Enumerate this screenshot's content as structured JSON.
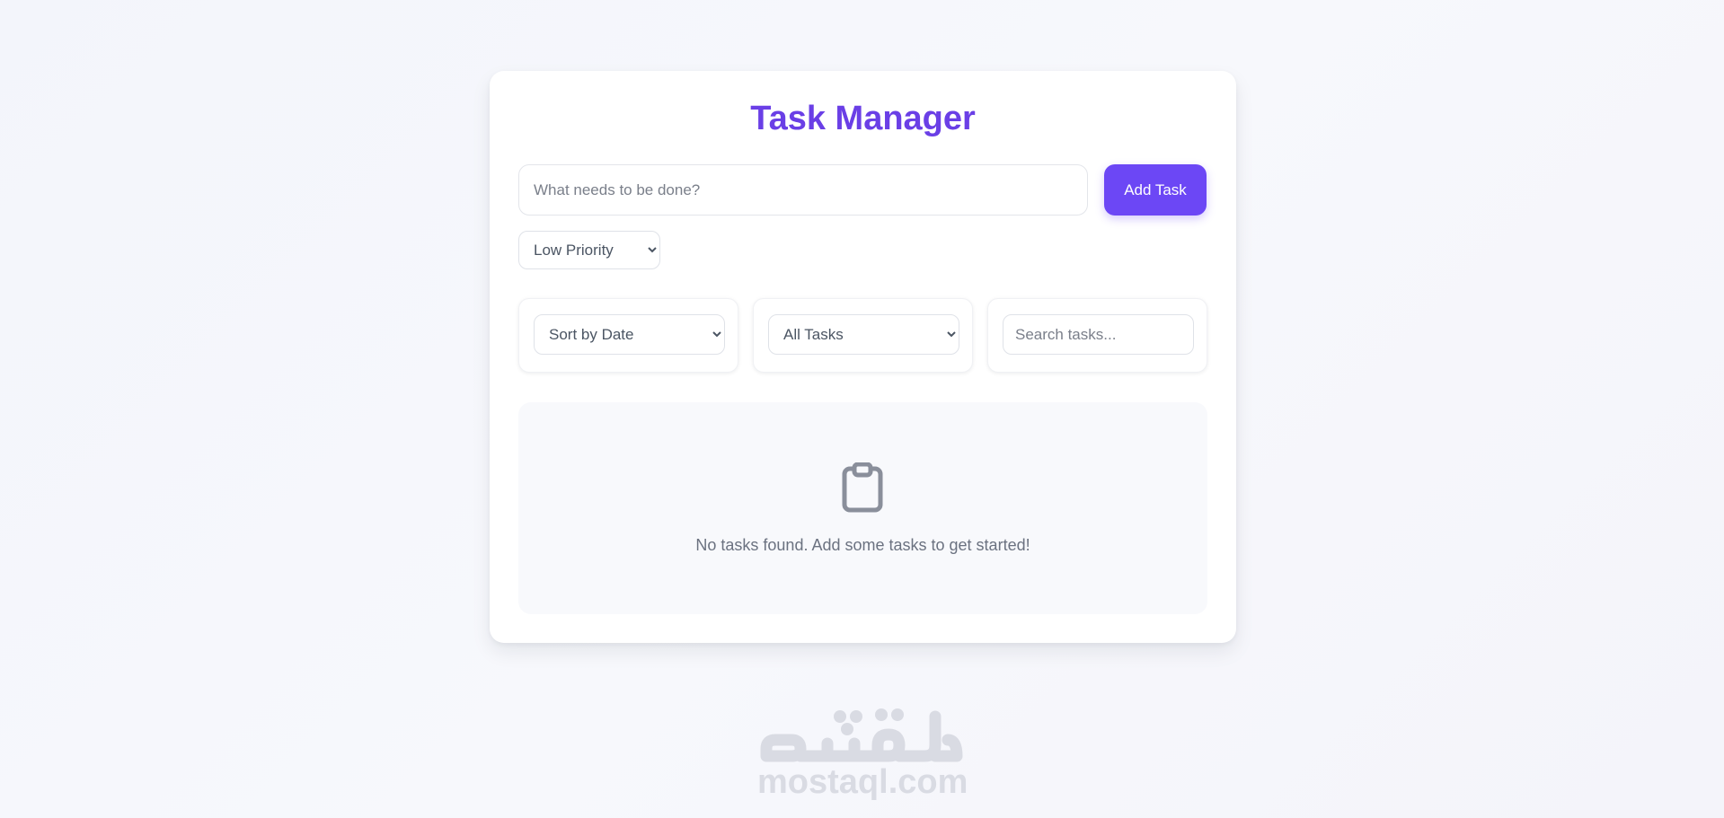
{
  "app": {
    "title": "Task Manager"
  },
  "new_task": {
    "placeholder": "What needs to be done?",
    "add_label": "Add Task",
    "priority_selected": "Low Priority"
  },
  "filters": {
    "sort_selected": "Sort by Date",
    "status_selected": "All Tasks",
    "search_placeholder": "Search tasks..."
  },
  "empty_state": {
    "icon": "clipboard-icon",
    "message": "No tasks found. Add some tasks to get started!"
  },
  "watermark": {
    "brand_arabic": "مستقل",
    "site": "mostaql.com"
  },
  "colors": {
    "accent": "#6c47f5",
    "title": "#6a3fe6",
    "muted_text": "#6b7280",
    "panel_bg": "#f8f9fc",
    "watermark": "#d9dbe3"
  }
}
